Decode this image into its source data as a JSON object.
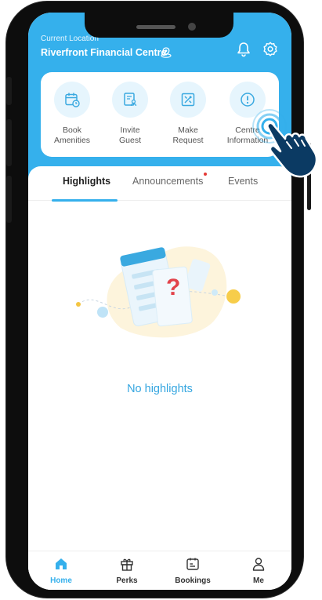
{
  "header": {
    "location_caption": "Current Location",
    "location_name": "Riverfront Financial Centre",
    "accent_color": "#35b0ec"
  },
  "quick_actions": [
    {
      "label": "Book\nAmenities",
      "icon": "calendar-clock-icon"
    },
    {
      "label": "Invite\nGuest",
      "icon": "guest-pass-icon"
    },
    {
      "label": "Make\nRequest",
      "icon": "request-tools-icon"
    },
    {
      "label": "Centre\nInformation",
      "icon": "info-icon"
    }
  ],
  "tabs": [
    {
      "label": "Highlights",
      "active": true
    },
    {
      "label": "Announcements",
      "active": false,
      "has_dot": true
    },
    {
      "label": "Events",
      "active": false
    }
  ],
  "empty_state": {
    "message": "No highlights"
  },
  "bottom_nav": [
    {
      "label": "Home",
      "icon": "home-icon",
      "active": true
    },
    {
      "label": "Perks",
      "icon": "gift-icon",
      "active": false
    },
    {
      "label": "Bookings",
      "icon": "bookings-icon",
      "active": false
    },
    {
      "label": "Me",
      "icon": "profile-icon",
      "active": false
    }
  ]
}
